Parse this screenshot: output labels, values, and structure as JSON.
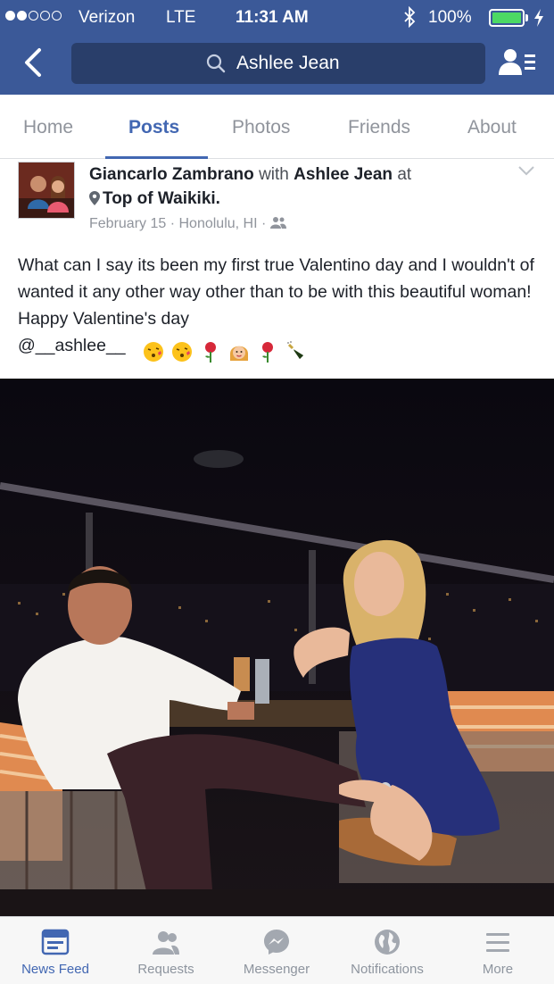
{
  "status_bar": {
    "carrier": "Verizon",
    "network": "LTE",
    "time": "11:31 AM",
    "battery": "100%",
    "battery_level": 1.0
  },
  "header": {
    "search_text": "Ashlee Jean",
    "back_icon": "chevron-left-icon",
    "friends_icon": "friend-requests-icon"
  },
  "profile_tabs": [
    {
      "label": "Home",
      "active": false
    },
    {
      "label": "Posts",
      "active": true
    },
    {
      "label": "Photos",
      "active": false
    },
    {
      "label": "Friends",
      "active": false
    },
    {
      "label": "About",
      "active": false
    }
  ],
  "post": {
    "author": "Giancarlo Zambrano",
    "with_word": "with",
    "tagged": "Ashlee Jean",
    "at_word": "at",
    "place": "Top of Waikiki.",
    "date": "February 15",
    "location": "Honolulu, HI",
    "sep": "·",
    "text": "What can I say its been my first true Valentino day and I wouldn't of wanted it any other way other than to be with this beautiful woman! Happy Valentine's day",
    "mention": "@__ashlee__",
    "emojis": [
      "kissing-face",
      "kissing-face",
      "rose",
      "woman-face",
      "rose",
      "champagne"
    ]
  },
  "bottom_tabs": [
    {
      "label": "News Feed",
      "icon": "news-feed-icon",
      "active": true
    },
    {
      "label": "Requests",
      "icon": "requests-icon",
      "active": false
    },
    {
      "label": "Messenger",
      "icon": "messenger-icon",
      "active": false
    },
    {
      "label": "Notifications",
      "icon": "notifications-globe-icon",
      "active": false
    },
    {
      "label": "More",
      "icon": "menu-icon",
      "active": false
    }
  ],
  "colors": {
    "brand": "#3b5998",
    "accent": "#4267b2",
    "battery_green": "#4cd964"
  }
}
